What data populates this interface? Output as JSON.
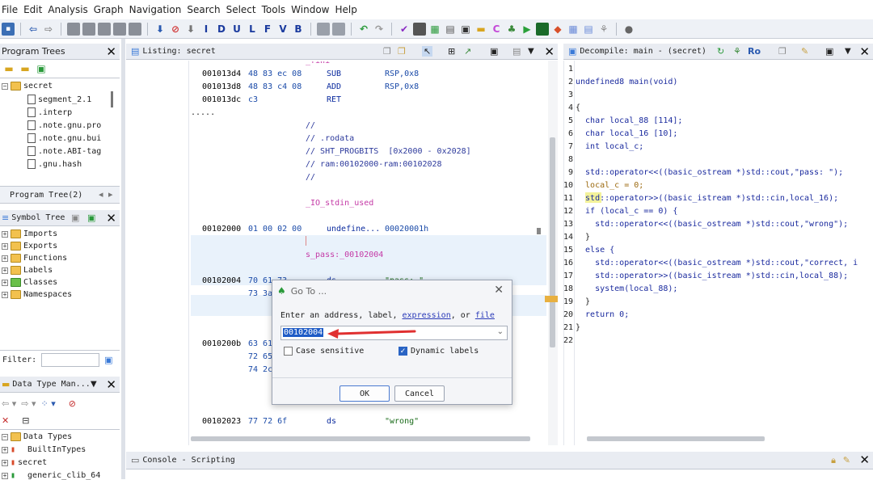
{
  "menubar": [
    "File",
    "Edit",
    "Analysis",
    "Graph",
    "Navigation",
    "Search",
    "Select",
    "Tools",
    "Window",
    "Help"
  ],
  "program_trees": {
    "title": "Program Trees",
    "root": "secret",
    "items": [
      "segment_2.1",
      ".interp",
      ".note.gnu.pro",
      ".note.gnu.bui",
      ".note.ABI-tag",
      ".gnu.hash"
    ],
    "tab_label": "Program Tree(2)"
  },
  "symbol_tree": {
    "title": "Symbol Tree",
    "items": [
      "Imports",
      "Exports",
      "Functions",
      "Labels",
      "Classes",
      "Namespaces"
    ],
    "filter_label": "Filter:"
  },
  "data_type_manager": {
    "title": "Data Type Man...",
    "root": "Data Types",
    "items": [
      "BuiltInTypes",
      "secret",
      "generic_clib_64"
    ]
  },
  "listing": {
    "title": "Listing:  secret",
    "top_label": "_fini",
    "rows": [
      {
        "addr": "001013d4",
        "bytes": "48 83 ec 08",
        "mnem": "SUB",
        "oper": "RSP,0x8"
      },
      {
        "addr": "001013d8",
        "bytes": "48 83 c4 08",
        "mnem": "ADD",
        "oper": "RSP,0x8"
      },
      {
        "addr": "001013dc",
        "bytes": "c3",
        "mnem": "RET",
        "oper": ""
      }
    ],
    "ellipsis": ".....",
    "comments": [
      "//",
      "// .rodata",
      "// SHT_PROGBITS  [0x2000 - 0x2028]",
      "// ram:00102000-ram:00102028",
      "//"
    ],
    "io_label": "_IO_stdin_used",
    "row_2000": {
      "addr": "00102000",
      "bytes": "01 00 02 00",
      "mnem": "undefine...",
      "oper": "00020001h"
    },
    "s_pass_label": "s_pass:_00102004",
    "row_2004": {
      "addr": "00102004",
      "bytes": "70 61 73",
      "mnem": "ds",
      "oper": "\"pass: \""
    },
    "row_2004b": {
      "bytes": "73 3a"
    },
    "row_200b": {
      "addr": "0010200b",
      "bytes": "63 61"
    },
    "row_200b2": {
      "bytes": "72 65"
    },
    "row_200b3": {
      "bytes": "74 2c"
    },
    "row_2023": {
      "addr": "00102023",
      "bytes": "77 72 6f",
      "mnem": "ds",
      "oper": "\"wrong\""
    }
  },
  "decompile": {
    "title": "Decompile: main -  (secret)",
    "line_numbers": [
      "1",
      "2",
      "3",
      "4",
      "5",
      "6",
      "7",
      "8",
      "9",
      "10",
      "11",
      "12",
      "13",
      "14",
      "15",
      "16",
      "17",
      "18",
      "19",
      "20",
      "21",
      "22"
    ],
    "lines": [
      "",
      "undefined8 main(void)",
      "",
      "{",
      "  char local_88 [114];",
      "  char local_16 [10];",
      "  int local_c;",
      "",
      "  std::operator<<((basic_ostream *)std::cout,\"pass: \");",
      "  local_c = 0;",
      "  std::operator>>((basic_istream *)std::cin,local_16);",
      "  if (local_c == 0) {",
      "    std::operator<<((basic_ostream *)std::cout,\"wrong\");",
      "  }",
      "  else {",
      "    std::operator<<((basic_ostream *)std::cout,\"correct, i",
      "    std::operator>>((basic_istream *)std::cin,local_88);",
      "    system(local_88);",
      "  }",
      "  return 0;",
      "}",
      ""
    ]
  },
  "console": {
    "title": "Console - Scripting"
  },
  "dialog": {
    "title": "Go To ...",
    "prompt_prefix": "Enter an address, label, ",
    "link_expression": "expression",
    "prompt_mid": ", or ",
    "link_file": "file",
    "input_value": "00102004",
    "case_sensitive": "Case sensitive",
    "dynamic_labels": "Dynamic labels",
    "ok": "OK",
    "cancel": "Cancel"
  },
  "colors": {
    "accent": "#2a64c4",
    "arrow": "#e03030"
  }
}
